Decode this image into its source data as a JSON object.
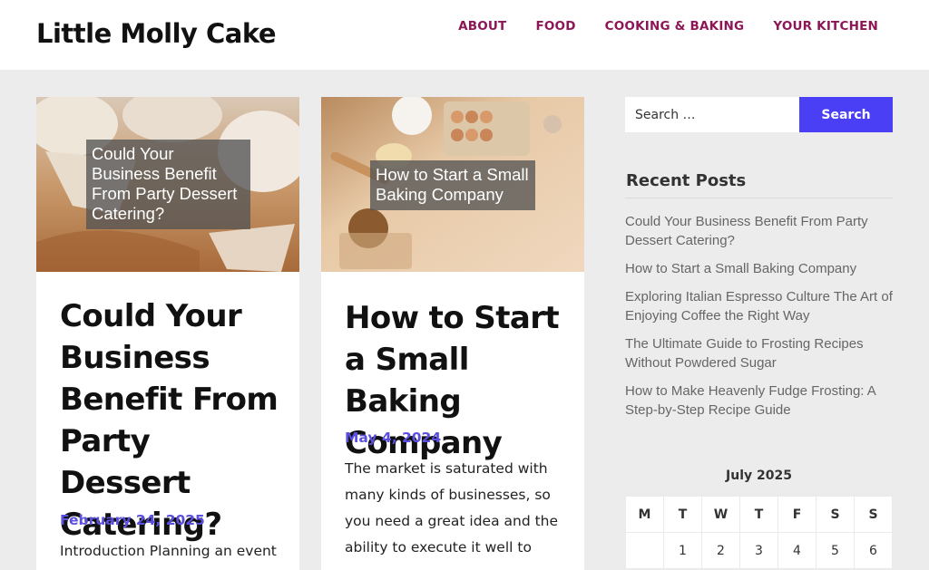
{
  "site": {
    "title": "Little Molly Cake"
  },
  "nav": {
    "items": [
      "ABOUT",
      "FOOD",
      "COOKING & BAKING",
      "YOUR KITCHEN"
    ]
  },
  "posts": [
    {
      "overlay": "Could Your Business Benefit From Party Dessert Catering?",
      "title": "Could Your Business Benefit From Party Dessert Catering?",
      "date": "February 24, 2025",
      "excerpt": "Introduction Planning an event"
    },
    {
      "overlay": "How to Start a Small Baking Company",
      "title": "How to Start a Small Baking Company",
      "date": "May 4, 2024",
      "excerpt": "The market is saturated with many kinds of businesses, so you need a great idea and the ability to execute it well to"
    }
  ],
  "search": {
    "placeholder": "Search …",
    "button_label": "Search"
  },
  "recent_posts": {
    "title": "Recent Posts",
    "items": [
      "Could Your Business Benefit From Party Dessert Catering?",
      "How to Start a Small Baking Company",
      "Exploring Italian Espresso Culture The Art of Enjoying Coffee the Right Way",
      "The Ultimate Guide to Frosting Recipes Without Powdered Sugar",
      "How to Make Heavenly Fudge Frosting: A Step-by-Step Recipe Guide"
    ]
  },
  "calendar": {
    "caption": "July 2025",
    "days": [
      "M",
      "T",
      "W",
      "T",
      "F",
      "S",
      "S"
    ],
    "first_row": [
      "",
      "1",
      "2",
      "3",
      "4",
      "5",
      "6"
    ]
  },
  "colors": {
    "accent": "#4b3ff5",
    "nav": "#8e1657",
    "date": "#5b4fe0"
  }
}
